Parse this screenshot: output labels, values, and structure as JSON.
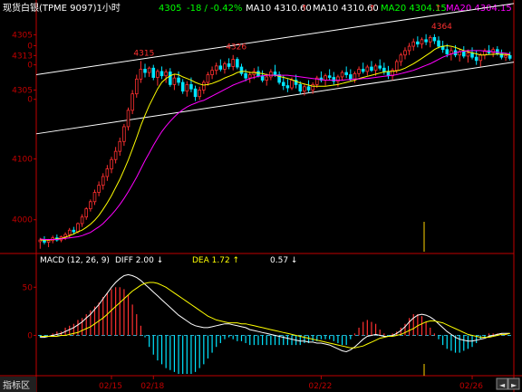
{
  "header": {
    "title": "现货白银(TPME 9097)1小时",
    "last": "4305",
    "change": "-18 / -0.42%",
    "ma10_a": "MA10 4310.60",
    "ma10_b": "MA10 4310.60",
    "ma20_a": "MA20 4304.15",
    "ma20_b": "MA20 4304.15"
  },
  "colors": {
    "bg": "#000000",
    "up": "#ff3030",
    "down": "#00e5ff",
    "ma10": "#ffff00",
    "ma20": "#ff00ff",
    "diff": "#ffffff",
    "dea": "#ffff00",
    "axis_red": "#c00000",
    "channel": "#ffffff"
  },
  "price_axis_labels": [
    {
      "text": "4305",
      "value": 4363
    },
    {
      "text": "0",
      "value": 4343
    },
    {
      "text": "4313",
      "value": 4325
    },
    {
      "text": "0",
      "value": 4308
    },
    {
      "text": "4305",
      "value": 4262
    },
    {
      "text": "0",
      "value": 4245
    },
    {
      "text": "4100",
      "value": 4136
    },
    {
      "text": "4000",
      "value": 4025
    }
  ],
  "annotations": [
    {
      "text": "4315",
      "index": 24,
      "value": 4315
    },
    {
      "text": "4326",
      "index": 46,
      "value": 4326
    },
    {
      "text": "4364",
      "index": 95,
      "value": 4364
    }
  ],
  "macd_header": {
    "name": "MACD (12, 26, 9)",
    "diff": "DIFF  2.00 ↓",
    "dea": "DEA  1.72 ↑",
    "macd": "0.57 ↓"
  },
  "macd_axis_labels": [
    {
      "text": "50",
      "value": 50
    },
    {
      "text": "0",
      "value": 0
    }
  ],
  "footer": {
    "indicator_tab": "指标区",
    "dates": [
      "02/15",
      "02/18",
      "02/22",
      "02/26"
    ]
  },
  "chart_data": [
    {
      "type": "candlestick",
      "title": "现货白银(TPME 9097)1小时",
      "ylim": [
        3970,
        4400
      ],
      "series_ohlc": [
        [
          3985,
          3992,
          3972,
          3988
        ],
        [
          3988,
          3995,
          3980,
          3984
        ],
        [
          3984,
          3990,
          3975,
          3987
        ],
        [
          3987,
          3996,
          3982,
          3992
        ],
        [
          3992,
          3998,
          3985,
          3988
        ],
        [
          3988,
          3996,
          3984,
          3994
        ],
        [
          3994,
          4002,
          3988,
          3998
        ],
        [
          3998,
          4010,
          3992,
          4006
        ],
        [
          4006,
          4012,
          3998,
          4003
        ],
        [
          4003,
          4020,
          4000,
          4018
        ],
        [
          4018,
          4035,
          4012,
          4030
        ],
        [
          4030,
          4048,
          4025,
          4045
        ],
        [
          4045,
          4062,
          4040,
          4058
        ],
        [
          4058,
          4080,
          4052,
          4075
        ],
        [
          4075,
          4095,
          4068,
          4088
        ],
        [
          4088,
          4110,
          4080,
          4104
        ],
        [
          4104,
          4125,
          4096,
          4118
        ],
        [
          4118,
          4140,
          4110,
          4135
        ],
        [
          4135,
          4158,
          4128,
          4150
        ],
        [
          4150,
          4175,
          4142,
          4168
        ],
        [
          4168,
          4200,
          4160,
          4195
        ],
        [
          4195,
          4230,
          4188,
          4225
        ],
        [
          4225,
          4262,
          4218,
          4255
        ],
        [
          4255,
          4290,
          4248,
          4282
        ],
        [
          4282,
          4315,
          4275,
          4300
        ],
        [
          4300,
          4310,
          4285,
          4294
        ],
        [
          4294,
          4305,
          4286,
          4302
        ],
        [
          4302,
          4308,
          4280,
          4285
        ],
        [
          4285,
          4300,
          4270,
          4296
        ],
        [
          4296,
          4305,
          4282,
          4288
        ],
        [
          4288,
          4300,
          4275,
          4295
        ],
        [
          4295,
          4302,
          4268,
          4272
        ],
        [
          4272,
          4290,
          4262,
          4284
        ],
        [
          4284,
          4296,
          4270,
          4276
        ],
        [
          4276,
          4282,
          4255,
          4260
        ],
        [
          4260,
          4278,
          4250,
          4272
        ],
        [
          4272,
          4285,
          4258,
          4264
        ],
        [
          4264,
          4270,
          4242,
          4250
        ],
        [
          4250,
          4268,
          4244,
          4262
        ],
        [
          4262,
          4280,
          4255,
          4276
        ],
        [
          4276,
          4295,
          4270,
          4290
        ],
        [
          4290,
          4305,
          4282,
          4298
        ],
        [
          4298,
          4312,
          4290,
          4306
        ],
        [
          4306,
          4318,
          4296,
          4300
        ],
        [
          4300,
          4314,
          4292,
          4310
        ],
        [
          4310,
          4320,
          4300,
          4305
        ],
        [
          4305,
          4326,
          4298,
          4318
        ],
        [
          4318,
          4322,
          4300,
          4304
        ],
        [
          4304,
          4310,
          4288,
          4292
        ],
        [
          4292,
          4300,
          4278,
          4284
        ],
        [
          4284,
          4296,
          4275,
          4290
        ],
        [
          4290,
          4302,
          4282,
          4296
        ],
        [
          4296,
          4305,
          4285,
          4288
        ],
        [
          4288,
          4298,
          4276,
          4280
        ],
        [
          4280,
          4292,
          4270,
          4286
        ],
        [
          4286,
          4300,
          4280,
          4295
        ],
        [
          4295,
          4308,
          4286,
          4290
        ],
        [
          4290,
          4296,
          4272,
          4276
        ],
        [
          4276,
          4288,
          4262,
          4270
        ],
        [
          4270,
          4282,
          4258,
          4266
        ],
        [
          4266,
          4285,
          4262,
          4280
        ],
        [
          4280,
          4290,
          4265,
          4272
        ],
        [
          4272,
          4278,
          4255,
          4260
        ],
        [
          4260,
          4274,
          4252,
          4268
        ],
        [
          4268,
          4280,
          4258,
          4262
        ],
        [
          4262,
          4276,
          4255,
          4272
        ],
        [
          4272,
          4288,
          4266,
          4284
        ],
        [
          4284,
          4296,
          4276,
          4280
        ],
        [
          4280,
          4292,
          4270,
          4288
        ],
        [
          4288,
          4300,
          4280,
          4285
        ],
        [
          4285,
          4295,
          4272,
          4278
        ],
        [
          4278,
          4290,
          4268,
          4286
        ],
        [
          4286,
          4298,
          4280,
          4294
        ],
        [
          4294,
          4305,
          4284,
          4290
        ],
        [
          4290,
          4300,
          4278,
          4282
        ],
        [
          4282,
          4296,
          4275,
          4292
        ],
        [
          4292,
          4305,
          4286,
          4300
        ],
        [
          4300,
          4312,
          4292,
          4296
        ],
        [
          4296,
          4308,
          4288,
          4304
        ],
        [
          4304,
          4315,
          4295,
          4298
        ],
        [
          4298,
          4310,
          4288,
          4306
        ],
        [
          4306,
          4318,
          4298,
          4302
        ],
        [
          4302,
          4312,
          4290,
          4296
        ],
        [
          4296,
          4306,
          4282,
          4288
        ],
        [
          4288,
          4302,
          4280,
          4298
        ],
        [
          4298,
          4318,
          4292,
          4314
        ],
        [
          4314,
          4330,
          4306,
          4326
        ],
        [
          4326,
          4340,
          4318,
          4334
        ],
        [
          4334,
          4348,
          4326,
          4342
        ],
        [
          4342,
          4356,
          4334,
          4350
        ],
        [
          4350,
          4360,
          4340,
          4346
        ],
        [
          4346,
          4358,
          4338,
          4354
        ],
        [
          4354,
          4364,
          4344,
          4350
        ],
        [
          4350,
          4362,
          4340,
          4358
        ],
        [
          4358,
          4364,
          4346,
          4352
        ],
        [
          4352,
          4360,
          4338,
          4342
        ],
        [
          4342,
          4352,
          4330,
          4336
        ],
        [
          4336,
          4346,
          4322,
          4328
        ],
        [
          4328,
          4340,
          4316,
          4334
        ],
        [
          4334,
          4344,
          4322,
          4326
        ],
        [
          4326,
          4338,
          4314,
          4332
        ],
        [
          4332,
          4342,
          4320,
          4324
        ],
        [
          4324,
          4336,
          4312,
          4330
        ],
        [
          4330,
          4340,
          4318,
          4322
        ],
        [
          4322,
          4334,
          4308,
          4316
        ],
        [
          4316,
          4330,
          4305,
          4326
        ],
        [
          4326,
          4338,
          4318,
          4334
        ],
        [
          4334,
          4344,
          4326,
          4330
        ],
        [
          4330,
          4340,
          4322,
          4336
        ],
        [
          4336,
          4342,
          4325,
          4328
        ],
        [
          4328,
          4336,
          4318,
          4322
        ],
        [
          4322,
          4330,
          4315,
          4325
        ],
        [
          4325,
          4332,
          4316,
          4320
        ]
      ],
      "ma10": [
        3988,
        3988,
        3988,
        3989,
        3990,
        3991,
        3993,
        3996,
        3999,
        4003,
        4006,
        4011,
        4017,
        4024,
        4033,
        4044,
        4056,
        4069,
        4084,
        4099,
        4116,
        4134,
        4154,
        4175,
        4197,
        4216,
        4234,
        4249,
        4264,
        4276,
        4283,
        4288,
        4291,
        4290,
        4286,
        4283,
        4280,
        4276,
        4273,
        4271,
        4272,
        4274,
        4277,
        4280,
        4284,
        4287,
        4290,
        4294,
        4296,
        4296,
        4294,
        4294,
        4293,
        4292,
        4290,
        4289,
        4289,
        4287,
        4285,
        4283,
        4281,
        4278,
        4275,
        4273,
        4271,
        4269,
        4269,
        4269,
        4269,
        4270,
        4271,
        4272,
        4274,
        4276,
        4278,
        4280,
        4283,
        4285,
        4287,
        4289,
        4291,
        4293,
        4295,
        4296,
        4296,
        4297,
        4299,
        4302,
        4306,
        4310,
        4315,
        4320,
        4325,
        4330,
        4336,
        4340,
        4342,
        4343,
        4342,
        4340,
        4337,
        4334,
        4332,
        4330,
        4328,
        4326,
        4326,
        4327,
        4327,
        4328,
        4327,
        4327,
        4326
      ],
      "ma20": [
        3990,
        3989,
        3989,
        3989,
        3989,
        3990,
        3991,
        3992,
        3993,
        3994,
        3996,
        3999,
        4002,
        4007,
        4012,
        4018,
        4026,
        4034,
        4043,
        4053,
        4064,
        4076,
        4089,
        4103,
        4118,
        4133,
        4147,
        4161,
        4174,
        4186,
        4196,
        4205,
        4213,
        4220,
        4226,
        4231,
        4235,
        4238,
        4241,
        4243,
        4247,
        4251,
        4255,
        4259,
        4263,
        4267,
        4271,
        4274,
        4277,
        4280,
        4283,
        4285,
        4287,
        4288,
        4289,
        4289,
        4289,
        4289,
        4289,
        4289,
        4288,
        4287,
        4286,
        4285,
        4284,
        4283,
        4282,
        4281,
        4280,
        4280,
        4280,
        4280,
        4280,
        4281,
        4281,
        4282,
        4282,
        4283,
        4283,
        4284,
        4285,
        4286,
        4287,
        4288,
        4289,
        4290,
        4292,
        4294,
        4296,
        4298,
        4301,
        4304,
        4307,
        4310,
        4314,
        4318,
        4322,
        4325,
        4328,
        4330,
        4332,
        4333,
        4334,
        4334,
        4334,
        4334,
        4333,
        4333,
        4332,
        4331,
        4330,
        4329,
        4328
      ]
    },
    {
      "type": "macd",
      "title": "MACD (12, 26, 9)",
      "ylim": [
        -40,
        70
      ],
      "diff": [
        -2,
        -2,
        -1,
        0,
        1,
        2,
        4,
        6,
        8,
        11,
        14,
        18,
        22,
        27,
        32,
        38,
        44,
        50,
        55,
        59,
        62,
        63,
        62,
        60,
        57,
        53,
        49,
        45,
        41,
        37,
        33,
        29,
        25,
        21,
        18,
        15,
        12,
        10,
        9,
        8,
        8,
        9,
        10,
        11,
        12,
        12,
        11,
        10,
        9,
        8,
        6,
        5,
        4,
        3,
        2,
        1,
        0,
        -1,
        -2,
        -3,
        -4,
        -5,
        -6,
        -6,
        -7,
        -7,
        -8,
        -8,
        -9,
        -10,
        -12,
        -14,
        -16,
        -17,
        -15,
        -12,
        -8,
        -4,
        -1,
        0,
        1,
        0,
        -1,
        -1,
        0,
        2,
        5,
        9,
        14,
        18,
        21,
        22,
        21,
        19,
        16,
        12,
        8,
        4,
        1,
        -2,
        -4,
        -5,
        -6,
        -6,
        -5,
        -4,
        -3,
        -1,
        0,
        1,
        2,
        2,
        2
      ],
      "dea": [
        -1,
        -1,
        -1,
        -1,
        -1,
        0,
        0,
        1,
        2,
        3,
        5,
        7,
        9,
        12,
        15,
        18,
        22,
        26,
        30,
        34,
        38,
        42,
        46,
        49,
        52,
        54,
        55,
        55,
        54,
        52,
        50,
        47,
        44,
        41,
        38,
        35,
        32,
        29,
        26,
        23,
        20,
        18,
        16,
        15,
        14,
        13,
        13,
        13,
        12,
        12,
        11,
        10,
        9,
        8,
        7,
        6,
        5,
        4,
        3,
        2,
        1,
        0,
        -1,
        -2,
        -3,
        -4,
        -5,
        -6,
        -7,
        -8,
        -9,
        -10,
        -11,
        -12,
        -13,
        -13,
        -12,
        -11,
        -9,
        -7,
        -5,
        -3,
        -2,
        -1,
        -1,
        0,
        1,
        3,
        5,
        7,
        10,
        12,
        14,
        15,
        15,
        14,
        13,
        11,
        9,
        7,
        5,
        3,
        1,
        0,
        -1,
        -2,
        -2,
        -2,
        -1,
        0,
        1,
        1,
        2
      ]
    }
  ]
}
